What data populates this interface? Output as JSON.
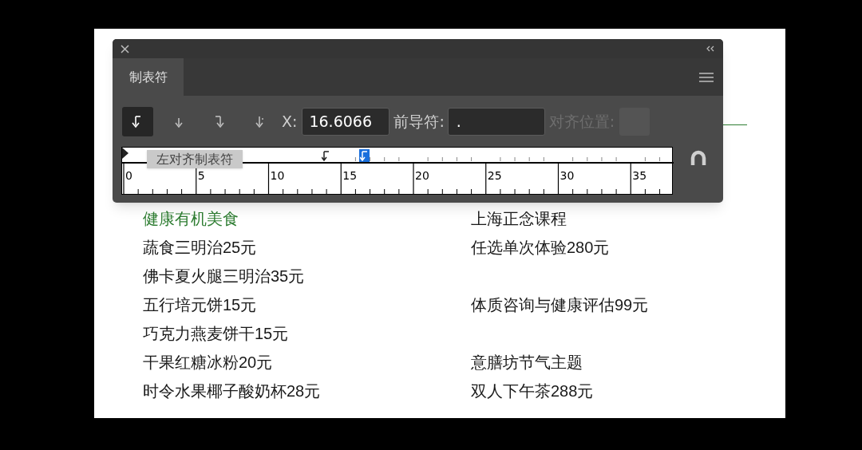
{
  "panel": {
    "tab": {
      "label": "制表符",
      "selected": true
    },
    "tab_types": [
      {
        "kind": "left",
        "selected": true
      },
      {
        "kind": "center",
        "selected": false
      },
      {
        "kind": "right",
        "selected": false
      },
      {
        "kind": "decimal",
        "selected": false
      }
    ],
    "x_label": "X:",
    "x_value": "16.6066",
    "leader_label": "前导符:",
    "leader_value": ".",
    "align_label": "对齐位置:",
    "align_disabled": true,
    "tooltip": "左对齐制表符",
    "ruler_labels": [
      "0",
      "5",
      "10",
      "15",
      "20",
      "25",
      "30",
      "35"
    ],
    "stops": [
      {
        "kind": "left",
        "selected": false
      },
      {
        "kind": "left",
        "selected": true
      }
    ],
    "snap_on": false
  },
  "document": {
    "rows": [
      {
        "left": {
          "text": "健康有机美食",
          "color": "#2e7d32"
        },
        "right": {
          "text": "上海正念课程",
          "color": "#1a1a1a"
        }
      },
      {
        "left": {
          "text": "蔬食三明治25元",
          "color": "#1a1a1a"
        },
        "right": {
          "text": "任选单次体验280元",
          "color": "#1a1a1a"
        }
      },
      {
        "left": {
          "text": "佛卡夏火腿三明治35元",
          "color": "#1a1a1a"
        }
      },
      {
        "left": {
          "text": "五行培元饼15元",
          "color": "#1a1a1a"
        },
        "right": {
          "text": "体质咨询与健康评估99元",
          "color": "#1a1a1a"
        }
      },
      {
        "left": {
          "text": "巧克力燕麦饼干15元",
          "color": "#1a1a1a"
        }
      },
      {
        "left": {
          "text": "干果红糖冰粉20元",
          "color": "#1a1a1a"
        },
        "right": {
          "text": "意膳坊节气主题",
          "color": "#1a1a1a"
        }
      },
      {
        "left": {
          "text": "时令水果椰子酸奶杯28元",
          "color": "#1a1a1a"
        },
        "right": {
          "text": "双人下午茶288元",
          "color": "#1a1a1a"
        }
      }
    ]
  }
}
